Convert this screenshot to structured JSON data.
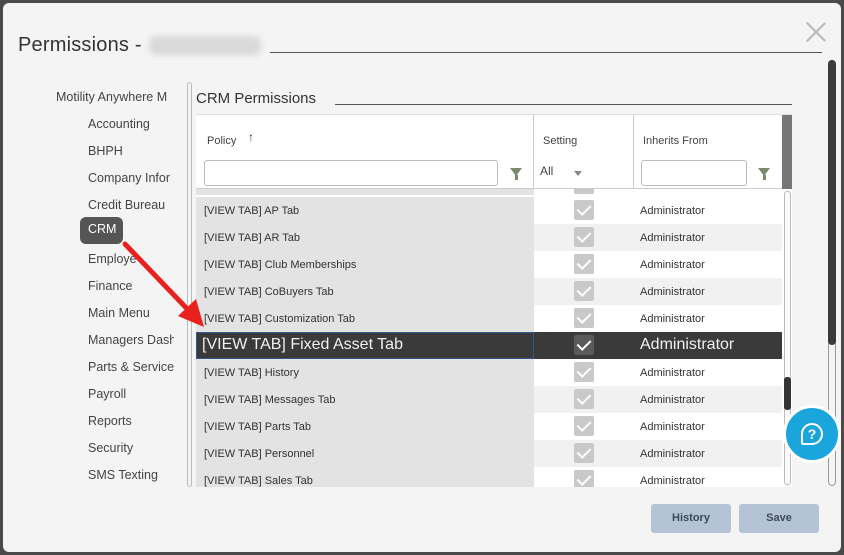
{
  "dialog": {
    "title": "Permissions -",
    "obscured_name_present": true
  },
  "sidebar": {
    "items": [
      {
        "label": "Motility Anywhere M",
        "level": 0
      },
      {
        "label": "Accounting",
        "level": 1
      },
      {
        "label": "BHPH",
        "level": 1
      },
      {
        "label": "Company Infor",
        "level": 1
      },
      {
        "label": "Credit Bureau",
        "level": 1
      },
      {
        "label": "CRM",
        "level": 1,
        "selected": true
      },
      {
        "label": "Employe",
        "level": 1
      },
      {
        "label": "Finance",
        "level": 1
      },
      {
        "label": "Main Menu",
        "level": 1
      },
      {
        "label": "Managers Dash",
        "level": 1
      },
      {
        "label": "Parts & Service",
        "level": 1
      },
      {
        "label": "Payroll",
        "level": 1
      },
      {
        "label": "Reports",
        "level": 1
      },
      {
        "label": "Security",
        "level": 1
      },
      {
        "label": "SMS Texting",
        "level": 1
      }
    ]
  },
  "section": {
    "title": "CRM Permissions"
  },
  "grid": {
    "columns": {
      "policy": "Policy",
      "setting": "Setting",
      "inherits": "Inherits From"
    },
    "sort_indicator": "↑",
    "filters": {
      "policy_value": "",
      "setting_value": "All",
      "inherits_value": ""
    },
    "rows": [
      {
        "policy": "[VIEW TAB] AP Tab",
        "checked": true,
        "inherits": "Administrator"
      },
      {
        "policy": "[VIEW TAB] AR Tab",
        "checked": true,
        "inherits": "Administrator"
      },
      {
        "policy": "[VIEW TAB] Club Memberships",
        "checked": true,
        "inherits": "Administrator"
      },
      {
        "policy": "[VIEW TAB] CoBuyers Tab",
        "checked": true,
        "inherits": "Administrator"
      },
      {
        "policy": "[VIEW TAB] Customization Tab",
        "checked": true,
        "inherits": "Administrator"
      },
      {
        "policy": "[VIEW TAB] Fixed Asset Tab",
        "checked": true,
        "inherits": "Administrator",
        "highlighted": true
      },
      {
        "policy": "[VIEW TAB] History",
        "checked": true,
        "inherits": "Administrator"
      },
      {
        "policy": "[VIEW TAB] Messages Tab",
        "checked": true,
        "inherits": "Administrator"
      },
      {
        "policy": "[VIEW TAB] Parts Tab",
        "checked": true,
        "inherits": "Administrator"
      },
      {
        "policy": "[VIEW TAB] Personnel",
        "checked": true,
        "inherits": "Administrator"
      },
      {
        "policy": "[VIEW TAB] Sales Tab",
        "checked": true,
        "inherits": "Administrator"
      }
    ]
  },
  "footer": {
    "history_label": "History",
    "save_label": "Save"
  },
  "help": {
    "glyph": "?"
  },
  "colors": {
    "accent_button": "#b5c3d6",
    "help_bubble": "#1aa6dc",
    "annotation_arrow": "#e8211f",
    "highlight_row": "#3a3a3a"
  }
}
